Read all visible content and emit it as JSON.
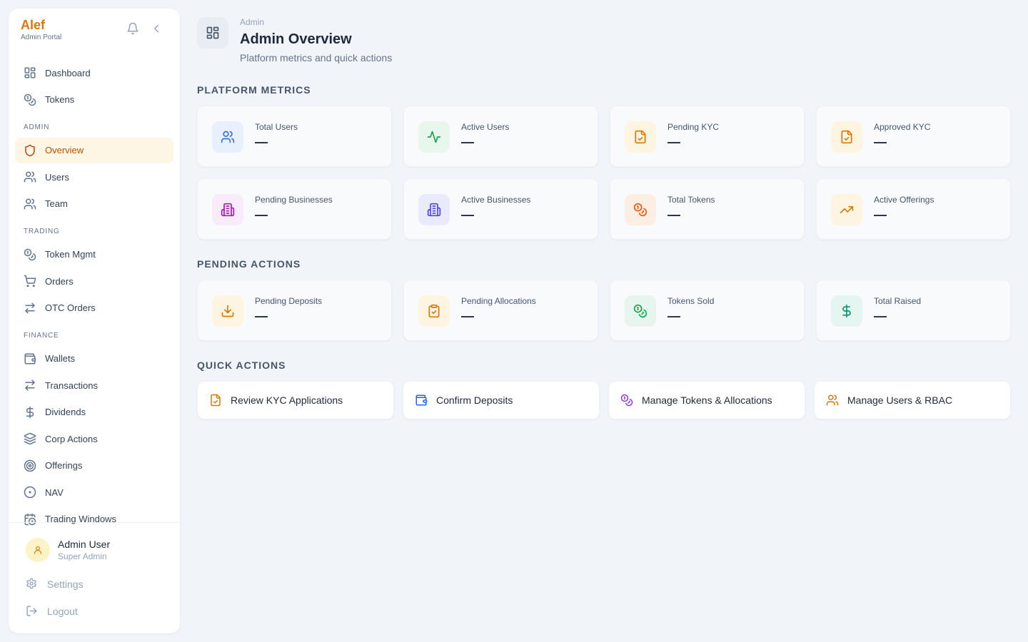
{
  "brand": {
    "name": "Alef",
    "subtitle": "Admin Portal"
  },
  "nav": {
    "top": [
      {
        "label": "Dashboard",
        "icon": "dashboard-icon"
      },
      {
        "label": "Tokens",
        "icon": "coins-icon"
      }
    ],
    "sections": [
      {
        "title": "ADMIN",
        "items": [
          {
            "label": "Overview",
            "icon": "shield-icon",
            "active": true
          },
          {
            "label": "Users",
            "icon": "users-icon"
          },
          {
            "label": "Team",
            "icon": "users-icon"
          }
        ]
      },
      {
        "title": "TRADING",
        "items": [
          {
            "label": "Token Mgmt",
            "icon": "coins-icon"
          },
          {
            "label": "Orders",
            "icon": "cart-icon"
          },
          {
            "label": "OTC Orders",
            "icon": "arrows-icon"
          }
        ]
      },
      {
        "title": "FINANCE",
        "items": [
          {
            "label": "Wallets",
            "icon": "wallet-icon"
          },
          {
            "label": "Transactions",
            "icon": "arrows-icon"
          },
          {
            "label": "Dividends",
            "icon": "dollar-icon"
          },
          {
            "label": "Corp Actions",
            "icon": "layers-icon"
          },
          {
            "label": "Offerings",
            "icon": "target-icon"
          },
          {
            "label": "NAV",
            "icon": "circle-dot-icon"
          },
          {
            "label": "Trading Windows",
            "icon": "calendar-clock-icon"
          }
        ]
      }
    ]
  },
  "user": {
    "name": "Admin User",
    "role": "Super Admin"
  },
  "bottom": {
    "settings": "Settings",
    "logout": "Logout"
  },
  "header": {
    "breadcrumb": "Admin",
    "title": "Admin Overview",
    "subtitle": "Platform metrics and quick actions"
  },
  "sections": {
    "metrics": "PLATFORM METRICS",
    "pending": "PENDING ACTIONS",
    "quick": "QUICK ACTIONS"
  },
  "metrics_row1": [
    {
      "label": "Total Users",
      "value": "—",
      "icon": "users-icon",
      "color": "#3b6fd8",
      "bg": "#e8f0fe"
    },
    {
      "label": "Active Users",
      "value": "—",
      "icon": "activity-icon",
      "color": "#16a34a",
      "bg": "#e8f7ee"
    },
    {
      "label": "Pending KYC",
      "value": "—",
      "icon": "file-check-icon",
      "color": "#d97706",
      "bg": "#fdf5e2"
    },
    {
      "label": "Approved KYC",
      "value": "—",
      "icon": "file-check-icon",
      "color": "#d97706",
      "bg": "#fdf5e2"
    }
  ],
  "metrics_row2": [
    {
      "label": "Pending Businesses",
      "value": "—",
      "icon": "building-icon",
      "color": "#a21caf",
      "bg": "#f8ecfb"
    },
    {
      "label": "Active Businesses",
      "value": "—",
      "icon": "building-icon",
      "color": "#4f46e5",
      "bg": "#e9ebfc"
    },
    {
      "label": "Total Tokens",
      "value": "—",
      "icon": "coins-icon",
      "color": "#ea580c",
      "bg": "#fdeee4"
    },
    {
      "label": "Active Offerings",
      "value": "—",
      "icon": "trending-up-icon",
      "color": "#d97706",
      "bg": "#fdf5e2"
    }
  ],
  "pending_actions": [
    {
      "label": "Pending Deposits",
      "value": "—",
      "icon": "download-icon",
      "color": "#d97706",
      "bg": "#fdf5e2"
    },
    {
      "label": "Pending Allocations",
      "value": "—",
      "icon": "clipboard-check-icon",
      "color": "#d97706",
      "bg": "#fdf5e2"
    },
    {
      "label": "Tokens Sold",
      "value": "—",
      "icon": "coins-icon",
      "color": "#16a34a",
      "bg": "#e6f6ee"
    },
    {
      "label": "Total Raised",
      "value": "—",
      "icon": "dollar-icon",
      "color": "#059669",
      "bg": "#e4f6ef"
    }
  ],
  "quick_actions": [
    {
      "label": "Review KYC Applications",
      "icon": "file-check-icon",
      "color": "#d97706"
    },
    {
      "label": "Confirm Deposits",
      "icon": "wallet-icon",
      "color": "#2563eb"
    },
    {
      "label": "Manage Tokens & Allocations",
      "icon": "coins-icon",
      "color": "#9333ea"
    },
    {
      "label": "Manage Users & RBAC",
      "icon": "users-icon",
      "color": "#d97706"
    }
  ]
}
